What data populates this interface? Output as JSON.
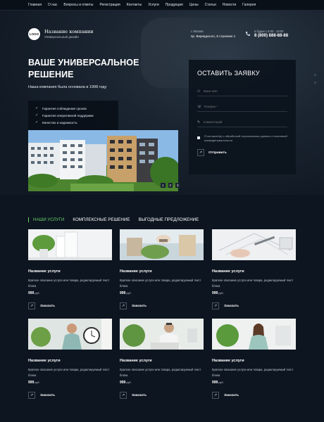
{
  "nav": {
    "items": [
      "Главная",
      "О нас",
      "Вопросы и ответы",
      "Регистрация",
      "Контакты",
      "Услуги",
      "Продукция",
      "Цены",
      "Статьи",
      "Новости",
      "Галерея"
    ]
  },
  "header": {
    "logo_text": "LOGO",
    "company_name": "Название компании",
    "company_tagline": "Универсальный дизайн",
    "address_city": "г. Москва",
    "address_street": "пр. Вернадского, 8 строение 1",
    "phone_hours": "в будни с 8:00 - 19:00",
    "phone_number": "8 (800) 888-88-88"
  },
  "hero": {
    "title": "ВАШЕ УНИВЕРСАЛЬНОЕ РЕШЕНИЕ",
    "subtitle": "Наша компания была основана в 1998 году",
    "features": [
      "Гарантия соблюдения сроков",
      "Гарантия оперативной поддержки",
      "Качество и надежность"
    ],
    "slider_pages": [
      "1",
      "2",
      "3"
    ]
  },
  "form": {
    "title": "ОСТАВИТЬ ЗАЯВКУ",
    "name_placeholder": "Ваше имя",
    "phone_placeholder": "Телефон *",
    "comment_placeholder": "Комментарий",
    "consent_text": "Я согласен(а) с обработкой персональных данных и политикой конфиденциальности",
    "submit_label": "Отправить"
  },
  "tabs": [
    "НАШИ УСЛУГИ",
    "КОМПЛЕКСНЫЕ РЕШЕНИЕ",
    "ВЫГОДНЫЕ ПРЕДЛОЖЕНИЕ"
  ],
  "cards": [
    {
      "title": "Название услуги",
      "desc": "Краткое описание услуги или товара, редактируемый текст блока",
      "price": "999",
      "currency": "руб.",
      "order": "Заказать"
    },
    {
      "title": "Название услуги",
      "desc": "Краткое описание услуги или товара, редактируемый текст блока",
      "price": "999",
      "currency": "руб.",
      "order": "Заказать"
    },
    {
      "title": "Название услуги",
      "desc": "Краткое описание услуги или товара, редактируемый текст блока",
      "price": "999",
      "currency": "руб.",
      "order": "Заказать"
    },
    {
      "title": "Название услуги",
      "desc": "Краткое описание услуги или товара, редактируемый текст блока",
      "price": "999",
      "currency": "руб.",
      "order": "Заказать"
    },
    {
      "title": "Название услуги",
      "desc": "Краткое описание услуги или товара, редактируемый текст блока",
      "price": "999",
      "currency": "руб.",
      "order": "Заказать"
    },
    {
      "title": "Название услуги",
      "desc": "Краткое описание услуги или товара, редактируемый текст блока",
      "price": "999",
      "currency": "руб.",
      "order": "Заказать"
    }
  ],
  "colors": {
    "background": "#0d1520",
    "accent_green": "#6ad06a",
    "panel": "#0c141e"
  },
  "icons": {
    "phone": "phone-icon",
    "check": "check-icon",
    "user": "user-icon",
    "arrow": "arrow-up-right-icon"
  }
}
